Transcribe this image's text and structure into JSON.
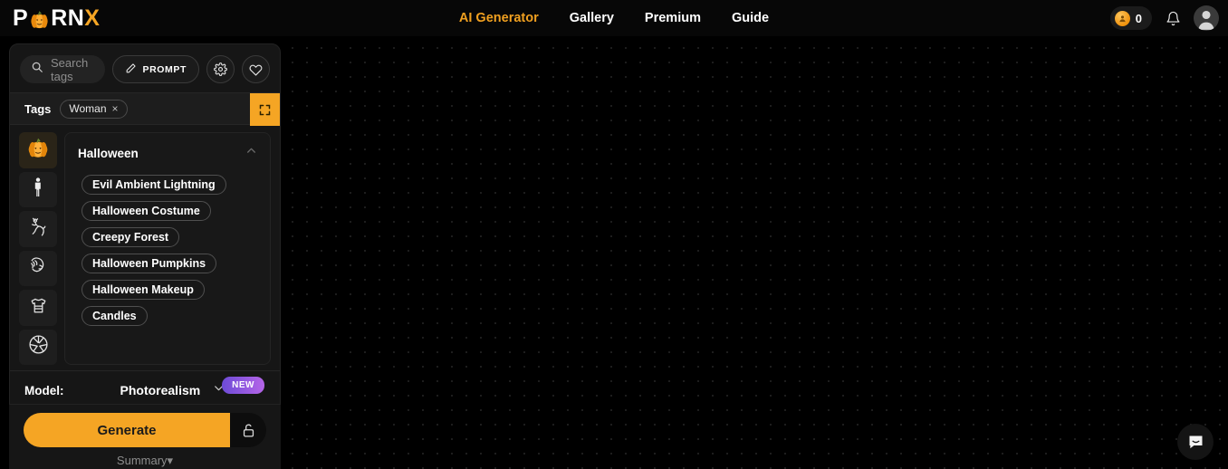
{
  "brand": {
    "logo_prefix": "P",
    "logo_mid": "RN",
    "logo_suffix": "X",
    "logo_icon": "pumpkin-icon",
    "accent": "#f5a524"
  },
  "nav": {
    "items": [
      {
        "label": "AI Generator",
        "active": true
      },
      {
        "label": "Gallery",
        "active": false
      },
      {
        "label": "Premium",
        "active": false
      },
      {
        "label": "Guide",
        "active": false
      }
    ]
  },
  "topright": {
    "coin_count": "0",
    "coin_icon": "coin-icon",
    "bell_icon": "bell-icon",
    "avatar_icon": "user-avatar-icon"
  },
  "toolbar": {
    "search_placeholder": "Search tags",
    "search_value": "",
    "search_icon": "search-icon",
    "prompt_label": "PROMPT",
    "prompt_icon": "pencil-icon",
    "settings_icon": "gear-icon",
    "favorites_icon": "heart-icon"
  },
  "tags_bar": {
    "label": "Tags",
    "selected": [
      {
        "label": "Woman",
        "remove": "×"
      }
    ],
    "expand_icon": "expand-icon"
  },
  "rail": {
    "items": [
      {
        "name": "halloween",
        "icon": "pumpkin-icon",
        "active": true
      },
      {
        "name": "body",
        "icon": "person-icon",
        "active": false
      },
      {
        "name": "pose",
        "icon": "pose-icon",
        "active": false
      },
      {
        "name": "face",
        "icon": "face-hair-icon",
        "active": false
      },
      {
        "name": "clothing",
        "icon": "tshirt-icon",
        "active": false
      },
      {
        "name": "camera",
        "icon": "aperture-icon",
        "active": false
      }
    ]
  },
  "group": {
    "title": "Halloween",
    "collapse_icon": "chevron-up-icon",
    "chips": [
      "Evil Ambient Lightning",
      "Halloween Costume",
      "Creepy Forest",
      "Halloween Pumpkins",
      "Halloween Makeup",
      "Candles"
    ]
  },
  "model": {
    "label": "Model:",
    "value": "Photorealism",
    "dropdown_icon": "chevron-down-icon",
    "badge": "NEW"
  },
  "actions": {
    "generate_label": "Generate",
    "lock_icon": "unlock-icon",
    "summary_label": "Summary",
    "summary_caret": "▾"
  },
  "canvas": {
    "chat_icon": "chat-bubble-icon"
  }
}
